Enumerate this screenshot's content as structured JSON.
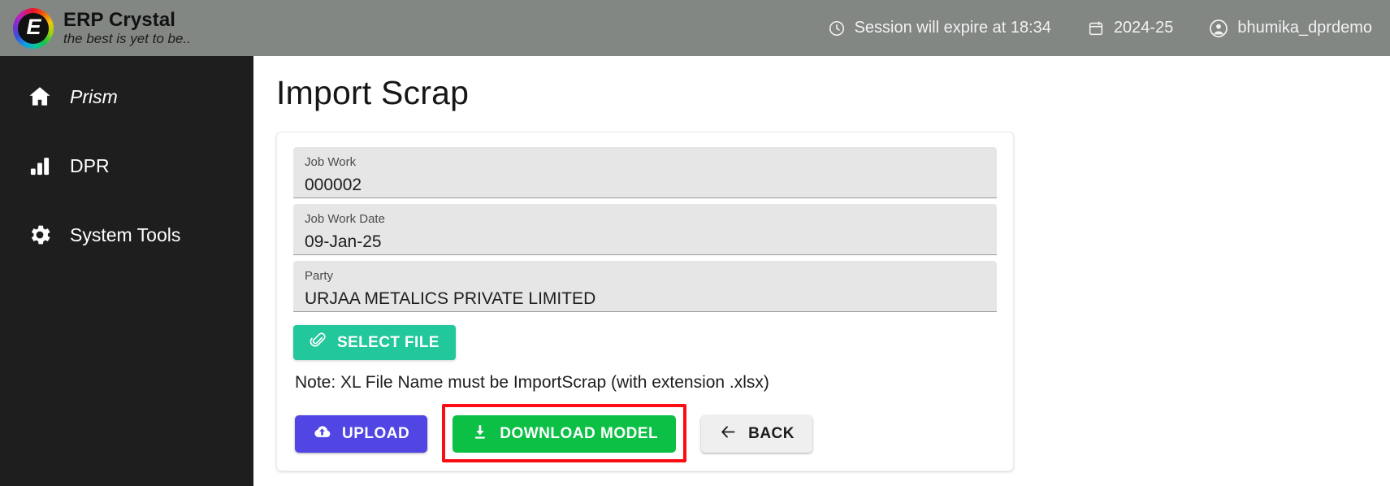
{
  "topbar": {
    "brand_title": "ERP Crystal",
    "brand_tagline": "the best is yet to be..",
    "logo_glyph": "E",
    "session_text": "Session will expire at 18:34",
    "fiscal_year": "2024-25",
    "user_name": "bhumika_dprdemo",
    "icons": {
      "clock": "clock-icon",
      "calendar": "calendar-icon",
      "user": "user-circle-icon"
    },
    "bg_color": "#828783"
  },
  "sidebar": {
    "bg_color": "#1e1e1e",
    "items": [
      {
        "label": "Prism",
        "icon": "home-icon",
        "italic": true
      },
      {
        "label": "DPR",
        "icon": "bar-chart-icon",
        "italic": false
      },
      {
        "label": "System Tools",
        "icon": "gear-icon",
        "italic": false
      }
    ]
  },
  "main": {
    "page_title": "Import Scrap",
    "fields": [
      {
        "label": "Job Work",
        "value": "000002"
      },
      {
        "label": "Job Work Date",
        "value": "09-Jan-25"
      },
      {
        "label": "Party",
        "value": "URJAA METALICS PRIVATE LIMITED"
      }
    ],
    "select_file": {
      "label": "SELECT FILE",
      "icon": "paperclip-icon",
      "color": "#22c79b"
    },
    "note": "Note: XL File Name must be ImportScrap (with extension .xlsx)",
    "buttons": [
      {
        "label": "UPLOAD",
        "icon": "cloud-upload-icon",
        "color": "#5145e3",
        "highlighted": false
      },
      {
        "label": "DOWNLOAD MODEL",
        "icon": "download-icon",
        "color": "#0cbf45",
        "highlighted": true
      },
      {
        "label": "BACK",
        "icon": "arrow-left-icon",
        "color": "#efefef",
        "highlighted": false
      }
    ],
    "highlight_color": "#fa0d15"
  }
}
